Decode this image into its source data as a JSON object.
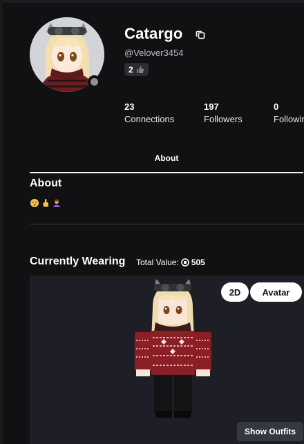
{
  "profile": {
    "display_name": "Catargo",
    "username": "@Velover3454",
    "badge_count": "2",
    "status": "offline"
  },
  "stats": [
    {
      "value": "23",
      "label": "Connections"
    },
    {
      "value": "197",
      "label": "Followers"
    },
    {
      "value": "0",
      "label": "Following"
    }
  ],
  "tabs": {
    "active": "About"
  },
  "about": {
    "title": "About",
    "emojis": [
      "face-emoji",
      "hand-emoji",
      "person-emoji"
    ]
  },
  "wearing": {
    "title": "Currently Wearing",
    "total_value_label": "Total Value:",
    "total_value": "505",
    "view_2d_label": "2D",
    "view_avatar_label": "Avatar",
    "show_outfits_label": "Show Outfits"
  },
  "colors": {
    "background": "#111114",
    "stage_background": "#1d1e26",
    "sweater_red": "#8c1f25",
    "hair_blonde": "#f3dfae"
  },
  "icons": [
    "copy-icon",
    "thumbs-up-icon",
    "robux-icon"
  ]
}
